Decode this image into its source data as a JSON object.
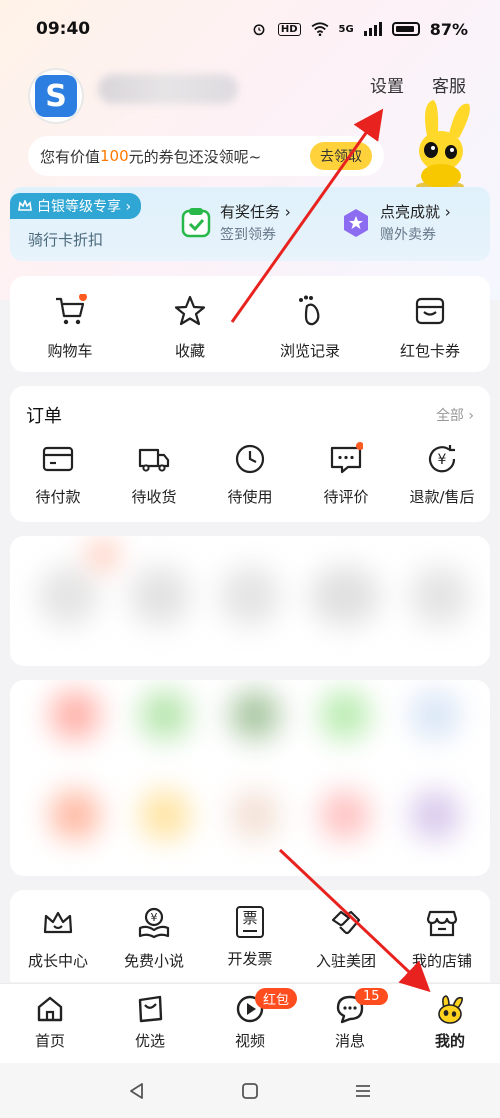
{
  "status_bar": {
    "time": "09:40",
    "battery_pct": "87%",
    "hd": "HD",
    "net": "5G"
  },
  "header": {
    "settings_label": "设置",
    "service_label": "客服"
  },
  "coupon": {
    "text_before": "您有价值",
    "amount": "100",
    "text_after": "元的券包还没领呢~",
    "button_label": "去领取"
  },
  "member": {
    "badge_label": "白银等级专享 ›",
    "badge_sub": "骑行卡折扣",
    "task": {
      "title": "有奖任务 ›",
      "sub": "签到领券"
    },
    "achieve": {
      "title": "点亮成就 ›",
      "sub": "赠外卖券"
    }
  },
  "quick_links": [
    {
      "label": "购物车",
      "icon": "cart-icon"
    },
    {
      "label": "收藏",
      "icon": "star-icon"
    },
    {
      "label": "浏览记录",
      "icon": "footprint-icon"
    },
    {
      "label": "红包卡券",
      "icon": "coupon-icon"
    }
  ],
  "orders": {
    "title": "订单",
    "all_label": "全部 ›",
    "items": [
      {
        "label": "待付款",
        "icon": "wallet-card-icon"
      },
      {
        "label": "待收货",
        "icon": "truck-icon"
      },
      {
        "label": "待使用",
        "icon": "clock-icon"
      },
      {
        "label": "待评价",
        "icon": "comment-icon"
      },
      {
        "label": "退款/售后",
        "icon": "refund-icon"
      }
    ]
  },
  "services": [
    {
      "label": "成长中心",
      "icon": "crown-icon"
    },
    {
      "label": "免费小说",
      "icon": "book-icon"
    },
    {
      "label": "开发票",
      "icon": "invoice-icon",
      "glyph": "票"
    },
    {
      "label": "入驻美团",
      "icon": "handshake-icon"
    },
    {
      "label": "我的店铺",
      "icon": "store-icon"
    }
  ],
  "tabbar": [
    {
      "label": "首页",
      "icon": "home-icon"
    },
    {
      "label": "优选",
      "icon": "bag-icon"
    },
    {
      "label": "视频",
      "icon": "play-icon",
      "badge": "红包"
    },
    {
      "label": "消息",
      "icon": "chat-icon",
      "badge": "15"
    },
    {
      "label": "我的",
      "icon": "kangaroo-icon",
      "active": true
    }
  ],
  "colors": {
    "accent": "#ffd23c",
    "orange": "#ff7a00",
    "badge_red": "#ff4d1f",
    "arrow_red": "#e8231f",
    "member_blue": "#2fa6d3"
  }
}
